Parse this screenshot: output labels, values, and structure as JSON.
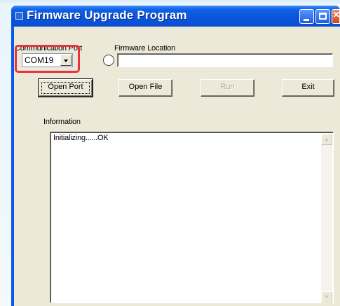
{
  "window": {
    "title": "Firmware Upgrade Program"
  },
  "port": {
    "label": "Communication Port",
    "value": "COM19"
  },
  "firmware": {
    "label": "Firmware Location",
    "value": ""
  },
  "buttons": {
    "open_port": "Open Port",
    "open_file": "Open File",
    "run": "Run",
    "exit": "Exit"
  },
  "info": {
    "label": "Information",
    "lines": [
      "Initializing......OK"
    ]
  },
  "colors": {
    "titlebar": "#0a54da",
    "highlight": "#e8323f",
    "client_bg": "#ece9d8"
  }
}
